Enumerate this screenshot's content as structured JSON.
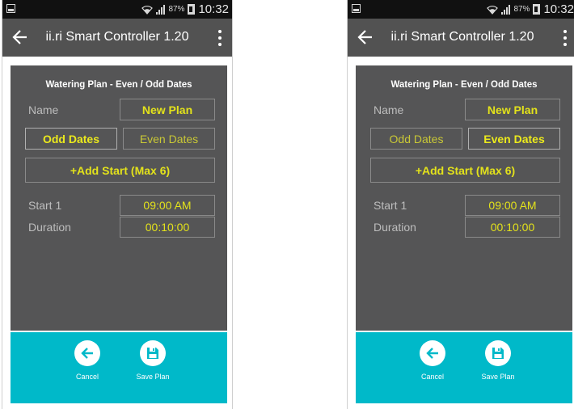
{
  "colors": {
    "status_bar": "#111111",
    "app_bar": "#525252",
    "panel": "#555556",
    "accent_yellow": "#e3e21b",
    "footer_teal": "#00b9c9"
  },
  "screens": [
    {
      "status": {
        "battery_pct": "87%",
        "time": "10:32"
      },
      "app_title": "ii.ri Smart Controller 1.20",
      "plan_title": "Watering Plan - Even / Odd Dates",
      "name_label": "Name",
      "name_value": "New Plan",
      "odd_label": "Odd Dates",
      "even_label": "Even Dates",
      "selected_dates": "odd",
      "add_start_label": "+Add Start (Max 6)",
      "start_label": "Start 1",
      "start_value": "09:00 AM",
      "duration_label": "Duration",
      "duration_value": "00:10:00",
      "cancel_label": "Cancel",
      "save_label": "Save Plan",
      "icons": [
        "back-arrow-icon",
        "overflow-menu-icon",
        "arrow-left-circle-icon",
        "floppy-disk-icon"
      ]
    },
    {
      "status": {
        "battery_pct": "87%",
        "time": "10:32"
      },
      "app_title": "ii.ri Smart Controller 1.20",
      "plan_title": "Watering Plan - Even / Odd Dates",
      "name_label": "Name",
      "name_value": "New Plan",
      "odd_label": "Odd Dates",
      "even_label": "Even Dates",
      "selected_dates": "even",
      "add_start_label": "+Add Start (Max 6)",
      "start_label": "Start 1",
      "start_value": "09:00 AM",
      "duration_label": "Duration",
      "duration_value": "00:10:00",
      "cancel_label": "Cancel",
      "save_label": "Save Plan",
      "icons": [
        "back-arrow-icon",
        "overflow-menu-icon",
        "arrow-left-circle-icon",
        "floppy-disk-icon"
      ]
    }
  ]
}
